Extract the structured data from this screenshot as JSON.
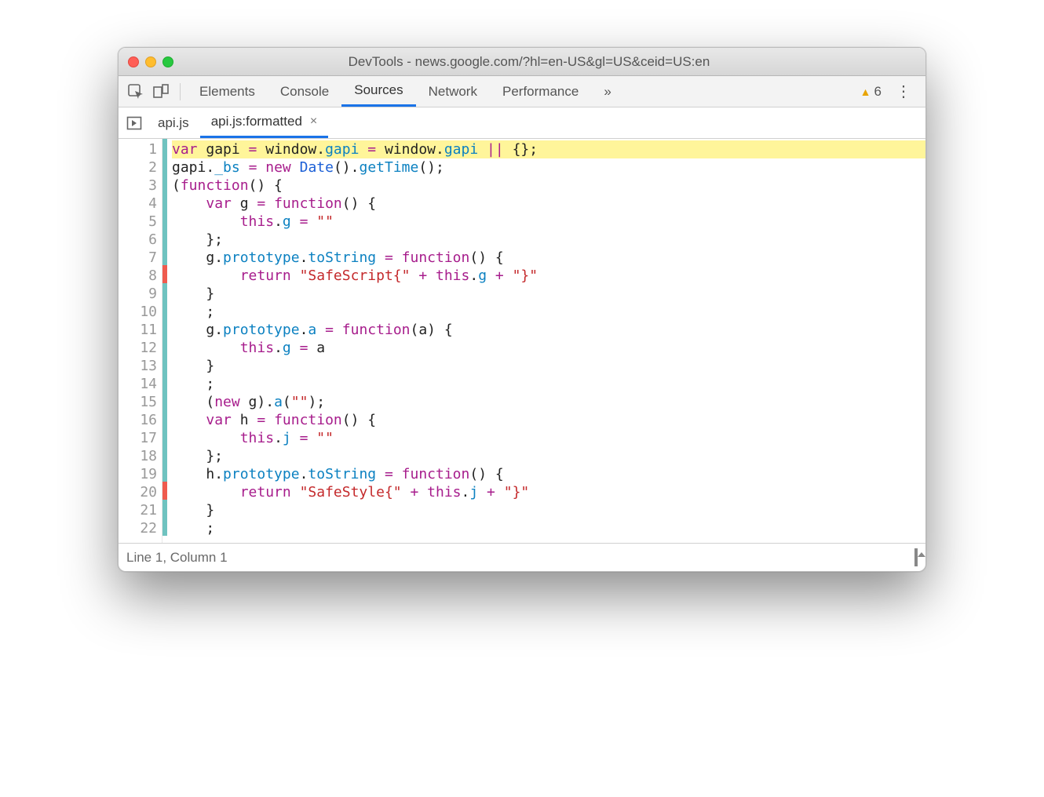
{
  "window": {
    "title": "DevTools - news.google.com/?hl=en-US&gl=US&ceid=US:en"
  },
  "tabs": {
    "items": [
      "Elements",
      "Console",
      "Sources",
      "Network",
      "Performance"
    ],
    "active": "Sources",
    "overflow": "»",
    "warnings": "6"
  },
  "fileTabs": {
    "items": [
      {
        "label": "api.js",
        "closable": false,
        "active": false
      },
      {
        "label": "api.js:formatted",
        "closable": true,
        "active": true
      }
    ]
  },
  "code": {
    "lines": [
      {
        "n": 1,
        "mark": "teal",
        "hl": true,
        "tokens": [
          [
            "kw",
            "var"
          ],
          [
            "",
            " gapi "
          ],
          [
            "op",
            "="
          ],
          [
            "",
            " window"
          ],
          [
            "",
            "."
          ],
          [
            "nm",
            "gapi"
          ],
          [
            "",
            " "
          ],
          [
            "op",
            "="
          ],
          [
            "",
            " window"
          ],
          [
            "",
            "."
          ],
          [
            "nm",
            "gapi"
          ],
          [
            "",
            " "
          ],
          [
            "op",
            "||"
          ],
          [
            "",
            " {};"
          ]
        ]
      },
      {
        "n": 2,
        "mark": "teal",
        "tokens": [
          [
            "",
            "gapi"
          ],
          [
            "",
            "."
          ],
          [
            "nm",
            "_bs"
          ],
          [
            "",
            " "
          ],
          [
            "op",
            "="
          ],
          [
            "",
            " "
          ],
          [
            "kw",
            "new"
          ],
          [
            "",
            " "
          ],
          [
            "id",
            "Date"
          ],
          [
            "",
            "()."
          ],
          [
            "nm",
            "getTime"
          ],
          [
            "",
            "();"
          ]
        ]
      },
      {
        "n": 3,
        "mark": "teal",
        "tokens": [
          [
            "",
            "("
          ],
          [
            "kw",
            "function"
          ],
          [
            "",
            "() {"
          ]
        ]
      },
      {
        "n": 4,
        "mark": "teal",
        "tokens": [
          [
            "",
            "    "
          ],
          [
            "kw",
            "var"
          ],
          [
            "",
            " g "
          ],
          [
            "op",
            "="
          ],
          [
            "",
            " "
          ],
          [
            "kw",
            "function"
          ],
          [
            "",
            "() {"
          ]
        ]
      },
      {
        "n": 5,
        "mark": "teal",
        "tokens": [
          [
            "",
            "        "
          ],
          [
            "kw",
            "this"
          ],
          [
            "",
            "."
          ],
          [
            "nm",
            "g"
          ],
          [
            "",
            " "
          ],
          [
            "op",
            "="
          ],
          [
            "",
            " "
          ],
          [
            "str",
            "\"\""
          ]
        ]
      },
      {
        "n": 6,
        "mark": "teal",
        "tokens": [
          [
            "",
            "    };"
          ]
        ]
      },
      {
        "n": 7,
        "mark": "teal",
        "tokens": [
          [
            "",
            "    g"
          ],
          [
            "",
            "."
          ],
          [
            "nm",
            "prototype"
          ],
          [
            "",
            "."
          ],
          [
            "nm",
            "toString"
          ],
          [
            "",
            " "
          ],
          [
            "op",
            "="
          ],
          [
            "",
            " "
          ],
          [
            "kw",
            "function"
          ],
          [
            "",
            "() {"
          ]
        ]
      },
      {
        "n": 8,
        "mark": "red",
        "tokens": [
          [
            "",
            "        "
          ],
          [
            "kw",
            "return"
          ],
          [
            "",
            " "
          ],
          [
            "str",
            "\"SafeScript{\""
          ],
          [
            "",
            " "
          ],
          [
            "op",
            "+"
          ],
          [
            "",
            " "
          ],
          [
            "kw",
            "this"
          ],
          [
            "",
            "."
          ],
          [
            "nm",
            "g"
          ],
          [
            "",
            " "
          ],
          [
            "op",
            "+"
          ],
          [
            "",
            " "
          ],
          [
            "str",
            "\"}\""
          ]
        ]
      },
      {
        "n": 9,
        "mark": "teal",
        "tokens": [
          [
            "",
            "    }"
          ]
        ]
      },
      {
        "n": 10,
        "mark": "teal",
        "tokens": [
          [
            "",
            "    ;"
          ]
        ]
      },
      {
        "n": 11,
        "mark": "teal",
        "tokens": [
          [
            "",
            "    g"
          ],
          [
            "",
            "."
          ],
          [
            "nm",
            "prototype"
          ],
          [
            "",
            "."
          ],
          [
            "nm",
            "a"
          ],
          [
            "",
            " "
          ],
          [
            "op",
            "="
          ],
          [
            "",
            " "
          ],
          [
            "kw",
            "function"
          ],
          [
            "",
            "(a) {"
          ]
        ]
      },
      {
        "n": 12,
        "mark": "teal",
        "tokens": [
          [
            "",
            "        "
          ],
          [
            "kw",
            "this"
          ],
          [
            "",
            "."
          ],
          [
            "nm",
            "g"
          ],
          [
            "",
            " "
          ],
          [
            "op",
            "="
          ],
          [
            "",
            " a"
          ]
        ]
      },
      {
        "n": 13,
        "mark": "teal",
        "tokens": [
          [
            "",
            "    }"
          ]
        ]
      },
      {
        "n": 14,
        "mark": "teal",
        "tokens": [
          [
            "",
            "    ;"
          ]
        ]
      },
      {
        "n": 15,
        "mark": "teal",
        "tokens": [
          [
            "",
            "    ("
          ],
          [
            "kw",
            "new"
          ],
          [
            "",
            " g)"
          ],
          [
            "",
            "."
          ],
          [
            "nm",
            "a"
          ],
          [
            "",
            "("
          ],
          [
            "str",
            "\"\""
          ],
          [
            "",
            ");"
          ]
        ]
      },
      {
        "n": 16,
        "mark": "teal",
        "tokens": [
          [
            "",
            "    "
          ],
          [
            "kw",
            "var"
          ],
          [
            "",
            " h "
          ],
          [
            "op",
            "="
          ],
          [
            "",
            " "
          ],
          [
            "kw",
            "function"
          ],
          [
            "",
            "() {"
          ]
        ]
      },
      {
        "n": 17,
        "mark": "teal",
        "tokens": [
          [
            "",
            "        "
          ],
          [
            "kw",
            "this"
          ],
          [
            "",
            "."
          ],
          [
            "nm",
            "j"
          ],
          [
            "",
            " "
          ],
          [
            "op",
            "="
          ],
          [
            "",
            " "
          ],
          [
            "str",
            "\"\""
          ]
        ]
      },
      {
        "n": 18,
        "mark": "teal",
        "tokens": [
          [
            "",
            "    };"
          ]
        ]
      },
      {
        "n": 19,
        "mark": "teal",
        "tokens": [
          [
            "",
            "    h"
          ],
          [
            "",
            "."
          ],
          [
            "nm",
            "prototype"
          ],
          [
            "",
            "."
          ],
          [
            "nm",
            "toString"
          ],
          [
            "",
            " "
          ],
          [
            "op",
            "="
          ],
          [
            "",
            " "
          ],
          [
            "kw",
            "function"
          ],
          [
            "",
            "() {"
          ]
        ]
      },
      {
        "n": 20,
        "mark": "red",
        "tokens": [
          [
            "",
            "        "
          ],
          [
            "kw",
            "return"
          ],
          [
            "",
            " "
          ],
          [
            "str",
            "\"SafeStyle{\""
          ],
          [
            "",
            " "
          ],
          [
            "op",
            "+"
          ],
          [
            "",
            " "
          ],
          [
            "kw",
            "this"
          ],
          [
            "",
            "."
          ],
          [
            "nm",
            "j"
          ],
          [
            "",
            " "
          ],
          [
            "op",
            "+"
          ],
          [
            "",
            " "
          ],
          [
            "str",
            "\"}\""
          ]
        ]
      },
      {
        "n": 21,
        "mark": "teal",
        "tokens": [
          [
            "",
            "    }"
          ]
        ]
      },
      {
        "n": 22,
        "mark": "teal",
        "tokens": [
          [
            "",
            "    ;"
          ]
        ]
      }
    ]
  },
  "status": {
    "text": "Line 1, Column 1"
  }
}
